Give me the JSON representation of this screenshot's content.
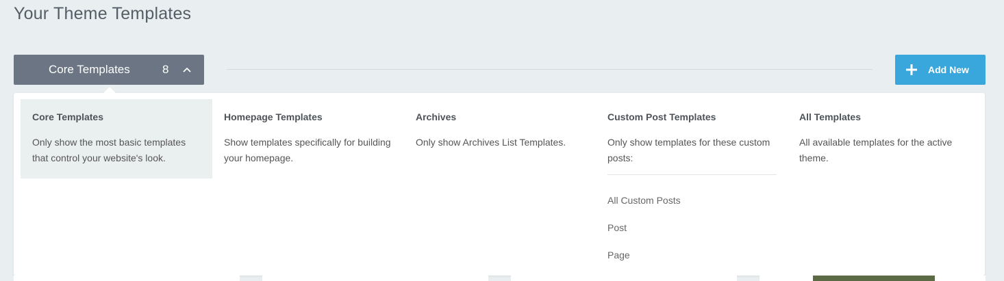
{
  "page": {
    "title": "Your Theme Templates"
  },
  "filter": {
    "label": "Core Templates",
    "count": "8",
    "icon": "chevron-up-icon"
  },
  "add_new": {
    "label": "Add New",
    "icon": "plus-icon"
  },
  "colors": {
    "background": "#e9eff0",
    "filter_button": "#6b7583",
    "accent": "#39a6dc",
    "active_item": "#eaeff0"
  },
  "menu": {
    "items": [
      {
        "title": "Core Templates",
        "description": "Only show the most basic templates that control your website's look.",
        "active": true
      },
      {
        "title": "Homepage Templates",
        "description": "Show templates specifically for building your homepage."
      },
      {
        "title": "Archives",
        "description": "Only show Archives List Templates."
      },
      {
        "title": "Custom Post Templates",
        "description": "Only show templates for these custom posts:",
        "sub_items": [
          "All Custom Posts",
          "Post",
          "Page"
        ]
      },
      {
        "title": "All Templates",
        "description": "All available templates for the active theme."
      }
    ]
  }
}
